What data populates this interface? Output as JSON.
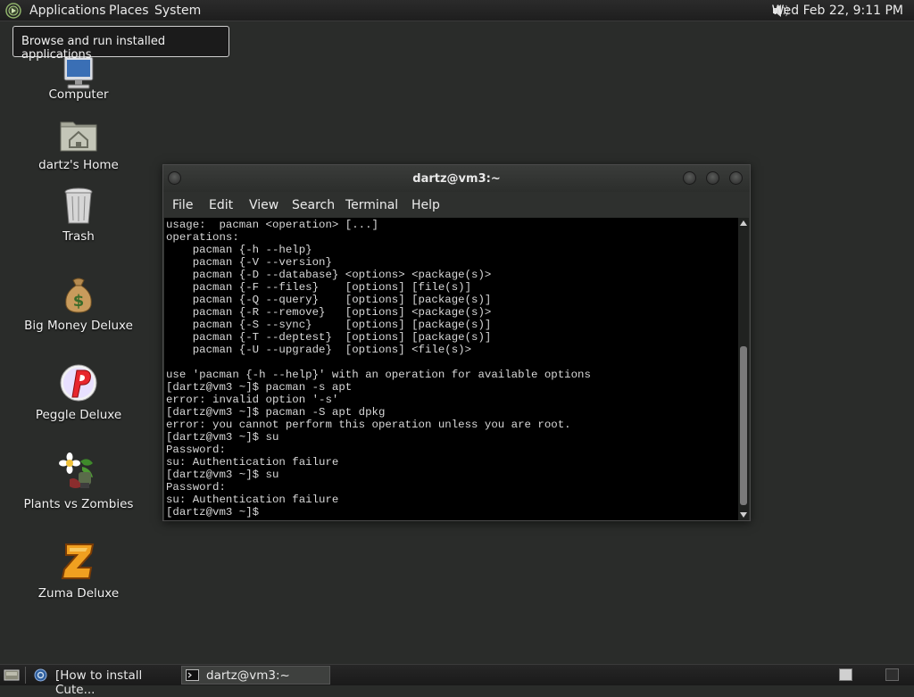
{
  "top_panel": {
    "menus": [
      "Applications",
      "Places",
      "System"
    ],
    "clock": "Wed Feb 22,  9:11 PM"
  },
  "tooltip": "Browse and run installed applications",
  "desktop_icons": [
    {
      "label": "Computer",
      "icon": "computer-icon"
    },
    {
      "label": "dartz's Home",
      "icon": "home-folder-icon"
    },
    {
      "label": "Trash",
      "icon": "trash-icon"
    },
    {
      "label": "Big Money Deluxe",
      "icon": "money-bag-icon"
    },
    {
      "label": "Peggle Deluxe",
      "icon": "peggle-icon"
    },
    {
      "label": "Plants vs Zombies",
      "icon": "plants-vs-zombies-icon"
    },
    {
      "label": "Zuma Deluxe",
      "icon": "zuma-icon"
    }
  ],
  "terminal": {
    "title": "dartz@vm3:~",
    "menus": [
      "File",
      "Edit",
      "View",
      "Search",
      "Terminal",
      "Help"
    ],
    "lines": [
      "usage:  pacman <operation> [...]",
      "operations:",
      "    pacman {-h --help}",
      "    pacman {-V --version}",
      "    pacman {-D --database} <options> <package(s)>",
      "    pacman {-F --files}    [options] [file(s)]",
      "    pacman {-Q --query}    [options] [package(s)]",
      "    pacman {-R --remove}   [options] <package(s)>",
      "    pacman {-S --sync}     [options] [package(s)]",
      "    pacman {-T --deptest}  [options] [package(s)]",
      "    pacman {-U --upgrade}  [options] <file(s)>",
      "",
      "use 'pacman {-h --help}' with an operation for available options",
      "[dartz@vm3 ~]$ pacman -s apt",
      "error: invalid option '-s'",
      "[dartz@vm3 ~]$ pacman -S apt dpkg",
      "error: you cannot perform this operation unless you are root.",
      "[dartz@vm3 ~]$ su",
      "Password:",
      "su: Authentication failure",
      "[dartz@vm3 ~]$ su",
      "Password:",
      "su: Authentication failure",
      "[dartz@vm3 ~]$"
    ]
  },
  "taskbar": {
    "items": [
      {
        "label": "[How to install Cute...",
        "icon": "browser-icon"
      },
      {
        "label": "dartz@vm3:~",
        "icon": "terminal-icon"
      }
    ]
  }
}
